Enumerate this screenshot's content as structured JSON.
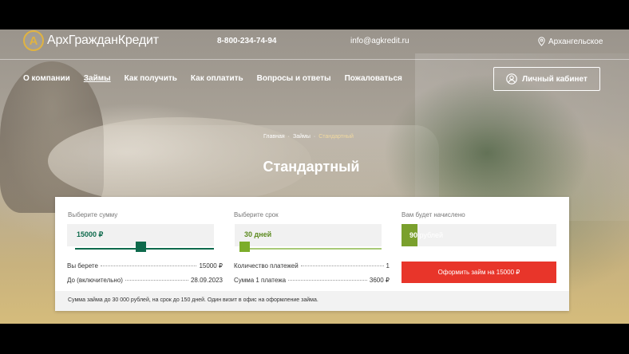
{
  "header": {
    "logo_letter": "А",
    "logo_text": "АрхГражданКредит",
    "phone": "8-800-234-74-94",
    "email": "info@agkredit.ru",
    "city": "Архангельское"
  },
  "nav": {
    "items": [
      {
        "label": "О компании",
        "active": false
      },
      {
        "label": "Займы",
        "active": true
      },
      {
        "label": "Как получить",
        "active": false
      },
      {
        "label": "Как оплатить",
        "active": false
      },
      {
        "label": "Вопросы и ответы",
        "active": false
      },
      {
        "label": "Пожаловаться",
        "active": false
      }
    ],
    "cabinet_label": "Личный кабинет"
  },
  "breadcrumb": {
    "items": [
      "Главная",
      "Займы",
      "Стандартный"
    ],
    "separator": "·"
  },
  "page": {
    "title": "Стандартный"
  },
  "calculator": {
    "amount": {
      "label": "Выберите сумму",
      "value": "15000 ₽",
      "level": 0.47
    },
    "term": {
      "label": "Выберите срок",
      "value": "30 дней",
      "level": 0.0
    },
    "accrue": {
      "label": "Вам будет начислено",
      "value": "90",
      "unit": "рублей",
      "level": 0.1
    },
    "summary_left": [
      {
        "label": "Вы берете",
        "value": "15000 ₽"
      },
      {
        "label": "До (включительно)",
        "value": "28.09.2023"
      }
    ],
    "summary_right": [
      {
        "label": "Количество платежей",
        "value": "1"
      },
      {
        "label": "Сумма 1 платежа",
        "value": "3600 ₽"
      }
    ],
    "apply_label": "Оформить займ на 15000 ₽",
    "footer_note": "Сумма займа до 30 000 рублей, на срок до 150 дней. Один визит в офис на оформление займа."
  },
  "colors": {
    "accent_green": "#0e6a4c",
    "light_green": "#7aa02d",
    "button_red": "#e8352a",
    "logo_gold": "#e0b341"
  }
}
